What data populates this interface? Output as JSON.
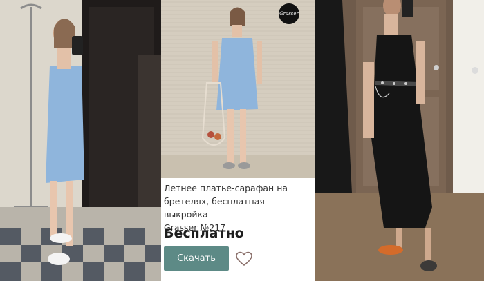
{
  "product": {
    "title_line1": "Летнее платье-сарафан на",
    "title_line2": "бретелях, бесплатная выкройка",
    "title_line3": "Grasser №217",
    "price": "Бесплатно",
    "download_label": "Скачать",
    "logo_text": "Grasser"
  },
  "colors": {
    "accent": "#5d8a86",
    "dress_blue": "#8fb5dc",
    "dress_black": "#151515",
    "heart": "#8a6f6a"
  }
}
